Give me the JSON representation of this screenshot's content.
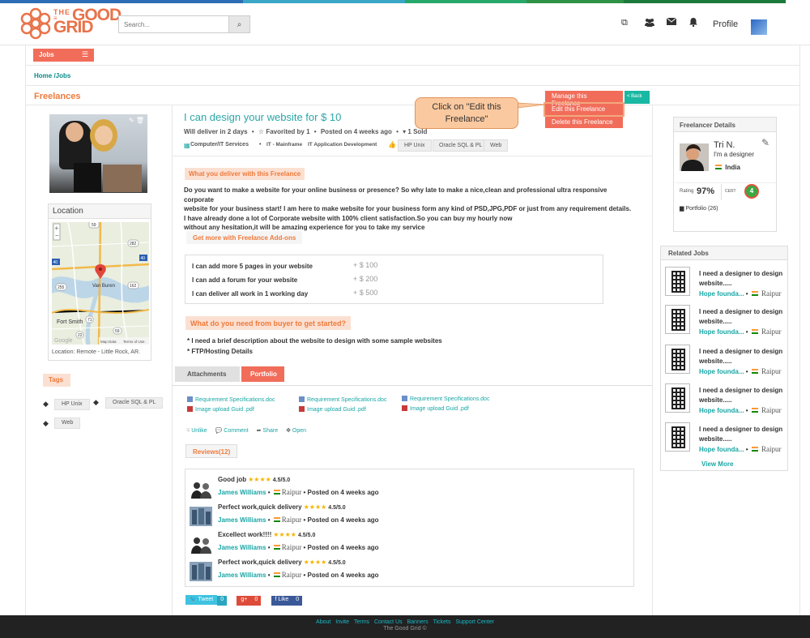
{
  "header": {
    "logo_line1": "THE",
    "logo_line2": "GOOD",
    "logo_line3": "GRID",
    "search_placeholder": "Search...",
    "profile_label": "Profile",
    "icons": [
      "external-link-icon",
      "users-icon",
      "envelope-icon",
      "bell-icon"
    ]
  },
  "nav": {
    "jobs_label": "Jobs"
  },
  "breadcrumb": "Home /Jobs",
  "section_title": "Freelances",
  "location": {
    "heading": "Location",
    "footer": "Location: Remote - Little Rock, AR.",
    "map_labels": {
      "city1": "Van Buren",
      "city2": "Fort Smith",
      "r1": "59",
      "r2": "282",
      "r3": "40",
      "r4": "255",
      "r5": "162",
      "r6": "71",
      "r7": "22",
      "r8": "59",
      "r9": "40",
      "attribution": "Map Data",
      "terms": "Terms of Use",
      "google": "Google"
    }
  },
  "tags": {
    "label": "Tags",
    "items": [
      "HP Unix",
      "Oracle SQL & PL",
      "Web"
    ]
  },
  "job": {
    "title": "I can design your website for $ 10",
    "meta": {
      "deliver": "Will deliver in 2 days",
      "favorited": "Favorited by 1",
      "posted": "Posted on 4 weeks ago",
      "sold": "1 Sold"
    },
    "category": "Computer/IT Services",
    "sub1": "IT - Mainframe",
    "sub2": "IT Application Development",
    "chips": [
      "HP Unix",
      "Oracle SQL & PL",
      "Web"
    ],
    "deliver_label": "What you deliver with this Freelance",
    "description": [
      "Do you want to make a website for your online business or presence? So why late to make a nice,clean and professional ultra responsive corporate",
      "website for your business start!   I am here to make website for your business form any kind of PSD,JPG,PDF or just from any requirement details.",
      "I have already done a lot of Corporate website with 100% client satisfaction.So you can buy my hourly now",
      "without any hesitation,it will be amazing experience for you to take my service"
    ],
    "addons_label": "Get more with Freelance Add-ons",
    "addons": [
      {
        "label": "I can add more 5 pages in your website",
        "price": "+ $  100"
      },
      {
        "label": "I can add a forum for your website",
        "price": "+ $  200"
      },
      {
        "label": "I can deliver all work in 1 working day",
        "price": "+ $  500"
      }
    ],
    "need_label": "What do you need from buyer to get started?",
    "requirements": [
      "* I need a brief description about the website to design with some sample websites",
      "* FTP/Hosting Details"
    ]
  },
  "actions": {
    "manage": "Manage this Freelance",
    "edit": "Edit this Freelance",
    "delete": "Delete this Freelance",
    "back": "< Back",
    "callout": "Click on \"Edit this Freelance\""
  },
  "tabs": {
    "attachments": "Attachments",
    "portfolio": "Portfolio"
  },
  "files": [
    {
      "name": "Requirement Specifications.doc",
      "type": "doc"
    },
    {
      "name": "Image upload Guid .pdf",
      "type": "pdf"
    },
    {
      "name": "Requirement Specifications.doc",
      "type": "doc"
    },
    {
      "name": "Image upload Guid .pdf",
      "type": "pdf"
    },
    {
      "name": "Requirement Specifications.doc",
      "type": "doc"
    },
    {
      "name": "Image upload Guid .pdf",
      "type": "pdf"
    }
  ],
  "social": {
    "unlike": "Unlike",
    "comment": "Comment",
    "share": "Share",
    "open": "Open"
  },
  "reviews": {
    "label": "Reviews(12)",
    "items": [
      {
        "title": "Good job",
        "stars": "★★★★",
        "score": "4.5/5.0",
        "name": "James Williams",
        "place": "Raipur",
        "posted": "Posted on 4 weeks ago"
      },
      {
        "title": "Perfect work,quick delivery",
        "stars": "★★★★",
        "score": "4.5/5.0",
        "name": "James Williams",
        "place": "Raipur",
        "posted": "Posted on 4 weeks ago"
      },
      {
        "title": "Excellect work!!!!",
        "stars": "★★★★",
        "score": "4.5/5.0",
        "name": "James Williams",
        "place": "Raipur",
        "posted": "Posted on 4 weeks ago"
      },
      {
        "title": "Perfect work,quick delivery",
        "stars": "★★★★",
        "score": "4.5/5.0",
        "name": "James Williams",
        "place": "Raipur",
        "posted": "Posted on 4 weeks ago"
      }
    ]
  },
  "share": {
    "tweet": "Tweet",
    "tweet_count": "0",
    "gplus": "g+",
    "gplus_count": "0",
    "like": "f Like",
    "like_count": "0"
  },
  "freelancer": {
    "heading": "Freelancer Details",
    "name": "Tri N.",
    "role": "I'm a designer",
    "country": "India",
    "rating_label": "Rating",
    "rating": "97%",
    "cert_label": "CERT",
    "cert_count": "4",
    "portfolio": "Portfolio (26)"
  },
  "related": {
    "heading": "Related  Jobs",
    "items": [
      {
        "title": "I need a designer to design website.....",
        "by": "Hope founda...",
        "place": "Raipur"
      },
      {
        "title": "I need a designer to design website.....",
        "by": "Hope founda...",
        "place": "Raipur"
      },
      {
        "title": "I need a designer to design website.....",
        "by": "Hope founda...",
        "place": "Raipur"
      },
      {
        "title": "I need a designer to design website.....",
        "by": "Hope founda...",
        "place": "Raipur"
      },
      {
        "title": "I need a designer to design website.....",
        "by": "Hope founda...",
        "place": "Raipur"
      }
    ],
    "view_more": "View More"
  },
  "footer": {
    "links": [
      "About",
      "Invite",
      "Terms",
      "Contact Us",
      "Banners",
      "Tickets",
      "Support Center"
    ],
    "copyright": "The Good Grid ©"
  },
  "colors": {
    "accent": "#f16d5a",
    "teal": "#19a6a6",
    "orange": "#ef7a3b",
    "footer": "#222222"
  }
}
